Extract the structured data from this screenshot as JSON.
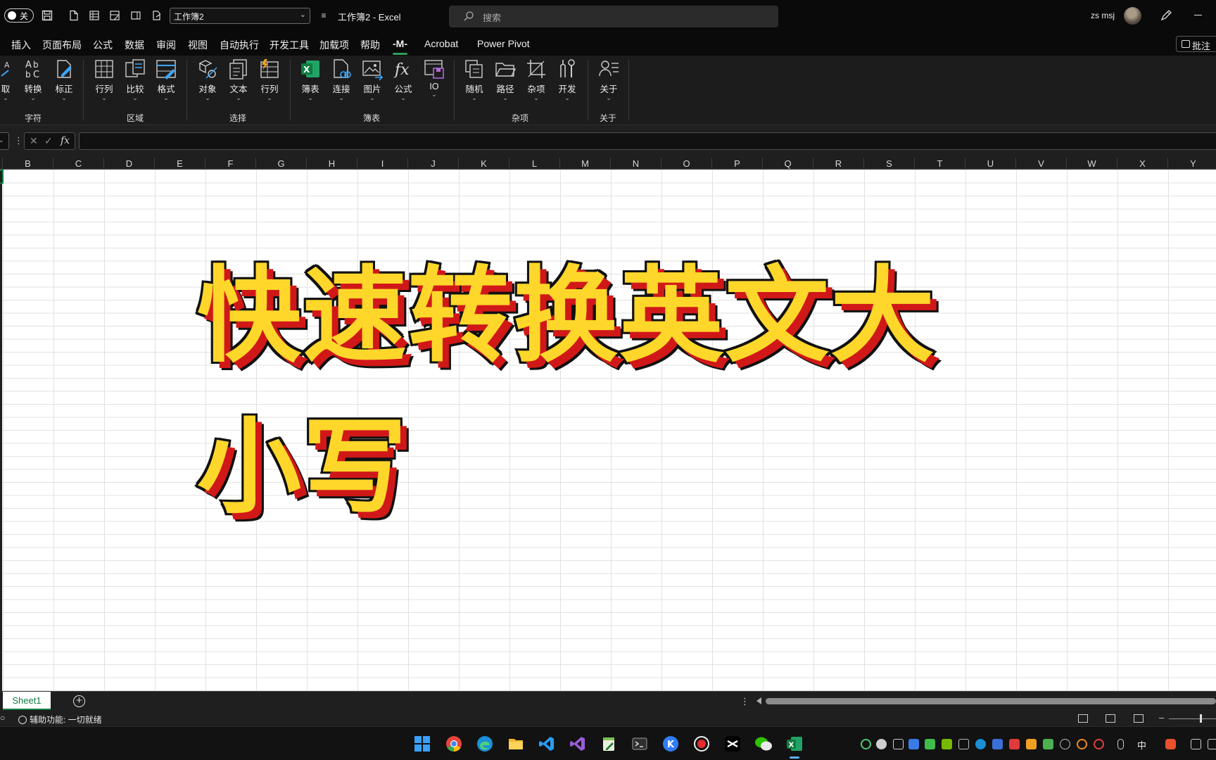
{
  "titlebar": {
    "autosave_label": "关",
    "workbook_select_value": "工作簿2",
    "doc_title": "工作簿2  -  Excel",
    "search_placeholder": "搜索",
    "user_name": "zs msj"
  },
  "menu": {
    "tabs": [
      "插入",
      "页面布局",
      "公式",
      "数据",
      "审阅",
      "视图",
      "自动执行",
      "开发工具",
      "加载项",
      "帮助",
      "-M-",
      "Acrobat",
      "Power Pivot"
    ],
    "active_tab": "-M-",
    "comment_button": "批注"
  },
  "ribbon": {
    "buttons": [
      "取",
      "转换",
      "标正",
      "行列",
      "比较",
      "格式",
      "对象",
      "文本",
      "行列",
      "簿表",
      "连接",
      "图片",
      "公式",
      "IO",
      "随机",
      "路径",
      "杂项",
      "开发",
      "关于"
    ],
    "groups": [
      "字符",
      "区域",
      "选择",
      "簿表",
      "杂项",
      "关于"
    ]
  },
  "formula_bar": {
    "fx_label": "fx",
    "value": ""
  },
  "grid": {
    "columns": [
      "B",
      "C",
      "D",
      "E",
      "F",
      "G",
      "H",
      "I",
      "J",
      "K",
      "L",
      "M",
      "N",
      "O",
      "P",
      "Q",
      "R",
      "S",
      "T",
      "U",
      "V",
      "W",
      "X",
      "Y"
    ]
  },
  "overlay": {
    "headline": "快速转换英文大小写",
    "fill_color": "#ffd72a",
    "shadow_color": "#d11818"
  },
  "sheet_tabs": {
    "tabs": [
      "Sheet1"
    ],
    "active": "Sheet1"
  },
  "statusbar": {
    "accessibility": "辅助功能: 一切就绪"
  },
  "taskbar": {
    "apps": [
      "windows-start",
      "chrome",
      "edge",
      "file-explorer",
      "vscode",
      "visual-studio",
      "notepad",
      "terminal",
      "k-app",
      "recorder",
      "capcut",
      "wechat",
      "excel"
    ],
    "active_app": "excel",
    "ime_label": "中"
  },
  "colors": {
    "accent": "#107c41",
    "background_dark": "#1f1f1f",
    "titlebar": "#0a0a0a"
  }
}
